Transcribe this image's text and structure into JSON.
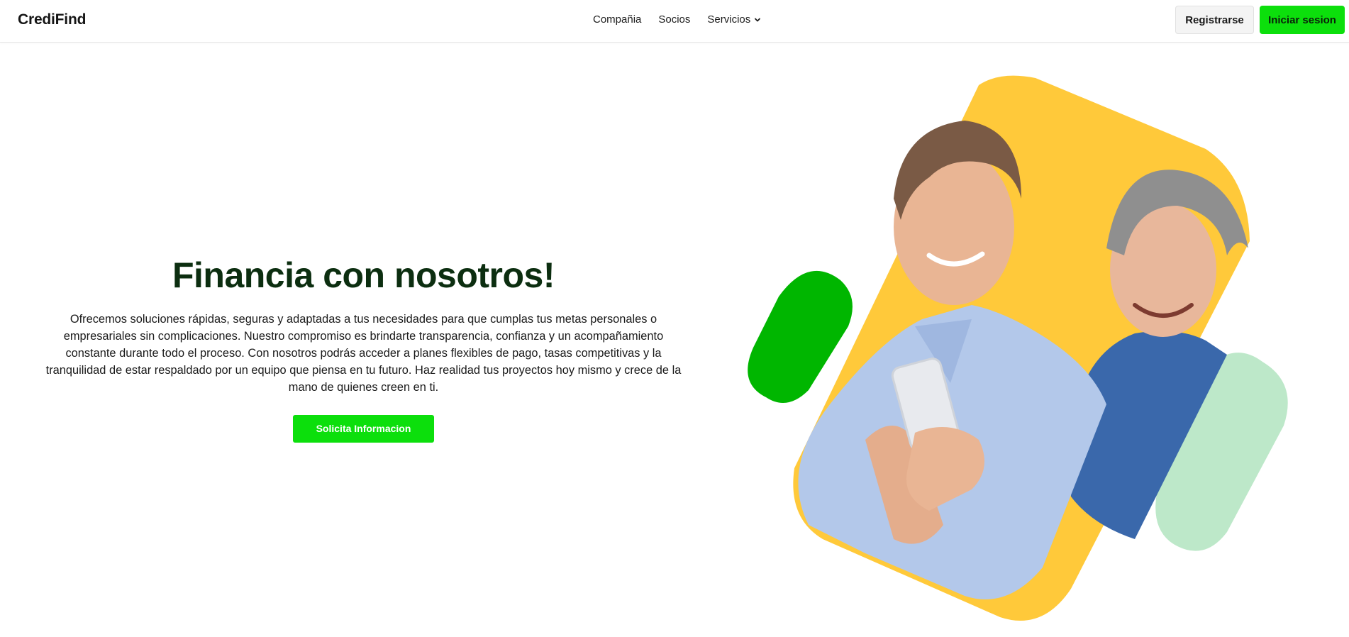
{
  "header": {
    "brand": "CrediFind",
    "nav": [
      {
        "label": "Compañia"
      },
      {
        "label": "Socios"
      },
      {
        "label": "Servicios"
      }
    ],
    "register_label": "Registrarse",
    "login_label": "Iniciar sesion"
  },
  "hero": {
    "title": "Financia con nosotros!",
    "description": "Ofrecemos soluciones rápidas, seguras y adaptadas a tus necesidades para que cumplas tus metas personales o empresariales sin complicaciones. Nuestro compromiso es brindarte transparencia, confianza y un acompañamiento constante durante todo el proceso. Con nosotros podrás acceder a planes flexibles de pago, tasas competitivas y la tranquilidad de estar respaldado por un equipo que piensa en tu futuro. Haz realidad tus proyectos hoy mismo y crece de la mano de quienes creen en ti.",
    "cta_label": "Solicita Informacion"
  },
  "colors": {
    "brand_green": "#0cdf0c",
    "dark_green": "#00b600",
    "light_green": "#bde8c9",
    "yellow": "#ffc93a",
    "title_green": "#0c2e10"
  }
}
